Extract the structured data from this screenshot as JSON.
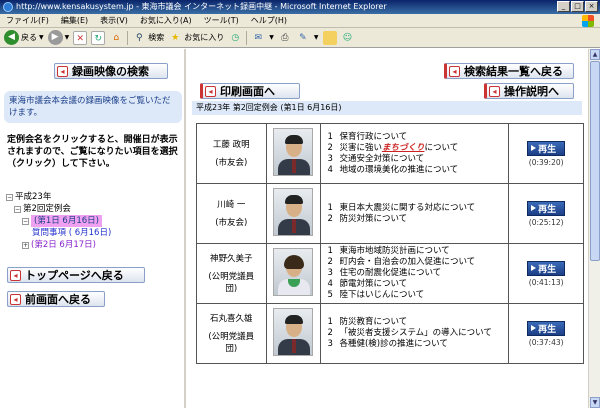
{
  "window": {
    "title": "http://www.kensakusystem.jp - 東海市議会 インターネット録画中継 - Microsoft Internet Explorer"
  },
  "menu": [
    "ファイル(F)",
    "編集(E)",
    "表示(V)",
    "お気に入り(A)",
    "ツール(T)",
    "ヘルプ(H)"
  ],
  "toolbar": {
    "back_label": "戻る",
    "search_label": "検索",
    "favorites_label": "お気に入り"
  },
  "left": {
    "video_search_button": "録画映像の検索",
    "info_text": "東海市議会本会議の録画映像をご覧いただけます。",
    "instructions": "定例会名をクリックすると、開催日が表示されますので、ご覧になりたい項目を選択（クリック）して下さい。",
    "tree": {
      "year": "平成23年",
      "session": "第2回定例会",
      "day1": "(第1日  6月16日)",
      "question": "質問事項  ( 6月16日)",
      "day2": "(第2日  6月17日)"
    },
    "top_page_button": "トップページへ戻る",
    "prev_page_button": "前画面へ戻る"
  },
  "right": {
    "results_button": "検索結果一覧へ戻る",
    "print_button": "印刷画面へ",
    "help_button": "操作説明へ",
    "session_header": "平成23年  第2回定例会 (第1日  6月16日)",
    "play_label": "再生",
    "speakers": [
      {
        "name": "工藤  政明",
        "party": "(市友会)",
        "topics": [
          {
            "num": "1",
            "text": "保育行政について"
          },
          {
            "num": "2",
            "pre": "災害に強い",
            "hl": "まちづくり",
            "post": "について"
          },
          {
            "num": "3",
            "text": "交通安全対策について"
          },
          {
            "num": "4",
            "text": "地域の環境美化の推進について"
          }
        ],
        "duration": "(0:39:20)",
        "photo": "male"
      },
      {
        "name": "川崎  一",
        "party": "(市友会)",
        "topics": [
          {
            "num": "1",
            "text": "東日本大震災に関する対応について"
          },
          {
            "num": "2",
            "text": "防災対策について"
          }
        ],
        "duration": "(0:25:12)",
        "photo": "male"
      },
      {
        "name": "神野久美子",
        "party": "(公明党議員団)",
        "topics": [
          {
            "num": "1",
            "text": "東海市地域防災計画について"
          },
          {
            "num": "2",
            "text": "町内会・自治会の加入促進について"
          },
          {
            "num": "3",
            "text": "住宅の耐震化促進について"
          },
          {
            "num": "4",
            "text": "節電対策について"
          },
          {
            "num": "5",
            "text": "陸下はいじんについて"
          }
        ],
        "duration": "(0:41:13)",
        "photo": "female"
      },
      {
        "name": "石丸喜久雄",
        "party": "(公明党議員団)",
        "topics": [
          {
            "num": "1",
            "text": "防災教育について"
          },
          {
            "num": "2",
            "text": "「被災者支援システム」の導入について"
          },
          {
            "num": "3",
            "text": "各種健(検)診の推進について"
          }
        ],
        "duration": "(0:37:43)",
        "photo": "male"
      }
    ]
  }
}
